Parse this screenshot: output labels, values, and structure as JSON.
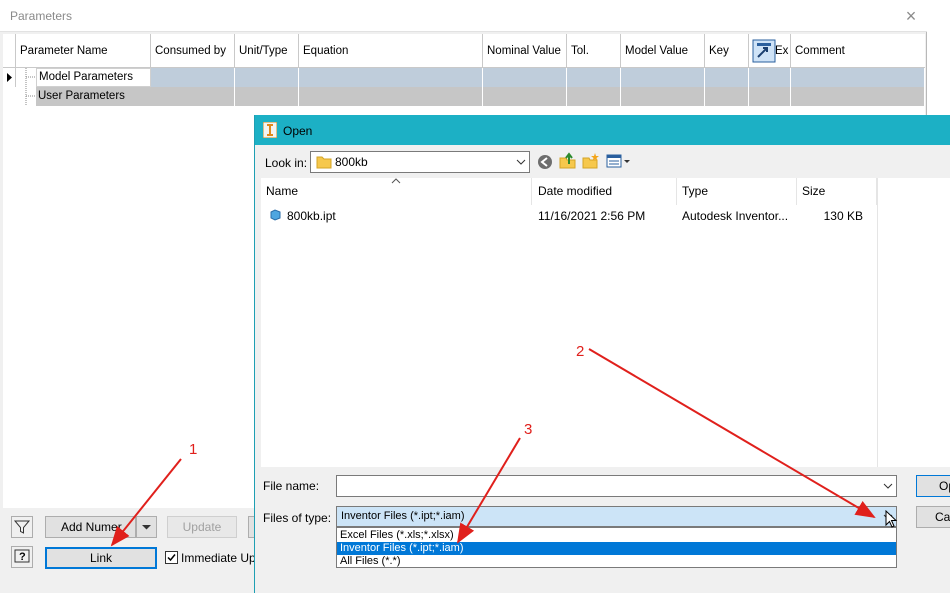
{
  "params_window": {
    "title": "Parameters",
    "close_glyph": "×",
    "columns": [
      "Parameter Name",
      "Consumed by",
      "Unit/Type",
      "Equation",
      "Nominal Value",
      "Tol.",
      "Model Value",
      "Key",
      "Ex",
      "Comment"
    ],
    "rows": [
      "Model Parameters",
      "User Parameters"
    ],
    "buttons": {
      "add_numeric": "Add Numer",
      "update": "Update",
      "link": "Link",
      "immediate_update": "Immediate Upd"
    }
  },
  "open_dialog": {
    "title": "Open",
    "look_in_label": "Look in:",
    "look_in_value": "800kb",
    "columns": [
      "Name",
      "Date modified",
      "Type",
      "Size"
    ],
    "files": [
      {
        "name": "800kb.ipt",
        "date": "11/16/2021 2:56 PM",
        "type": "Autodesk Inventor...",
        "size": "130 KB"
      }
    ],
    "file_name_label": "File name:",
    "file_name_value": "",
    "files_of_type_label": "Files of type:",
    "files_of_type_value": "Inventor Files (*.ipt;*.iam)",
    "type_options": [
      "Excel Files (*.xls;*.xlsx)",
      "Inventor Files (*.ipt;*.iam)",
      "All Files (*.*)"
    ],
    "open_button": "Op",
    "cancel_button": "Car"
  },
  "annotations": [
    "1",
    "2",
    "3"
  ],
  "colors": {
    "title_bar": "#1cb0c5",
    "selection": "#0078d7",
    "arrow": "#e0201c",
    "link_button_border": "#0078d7"
  }
}
